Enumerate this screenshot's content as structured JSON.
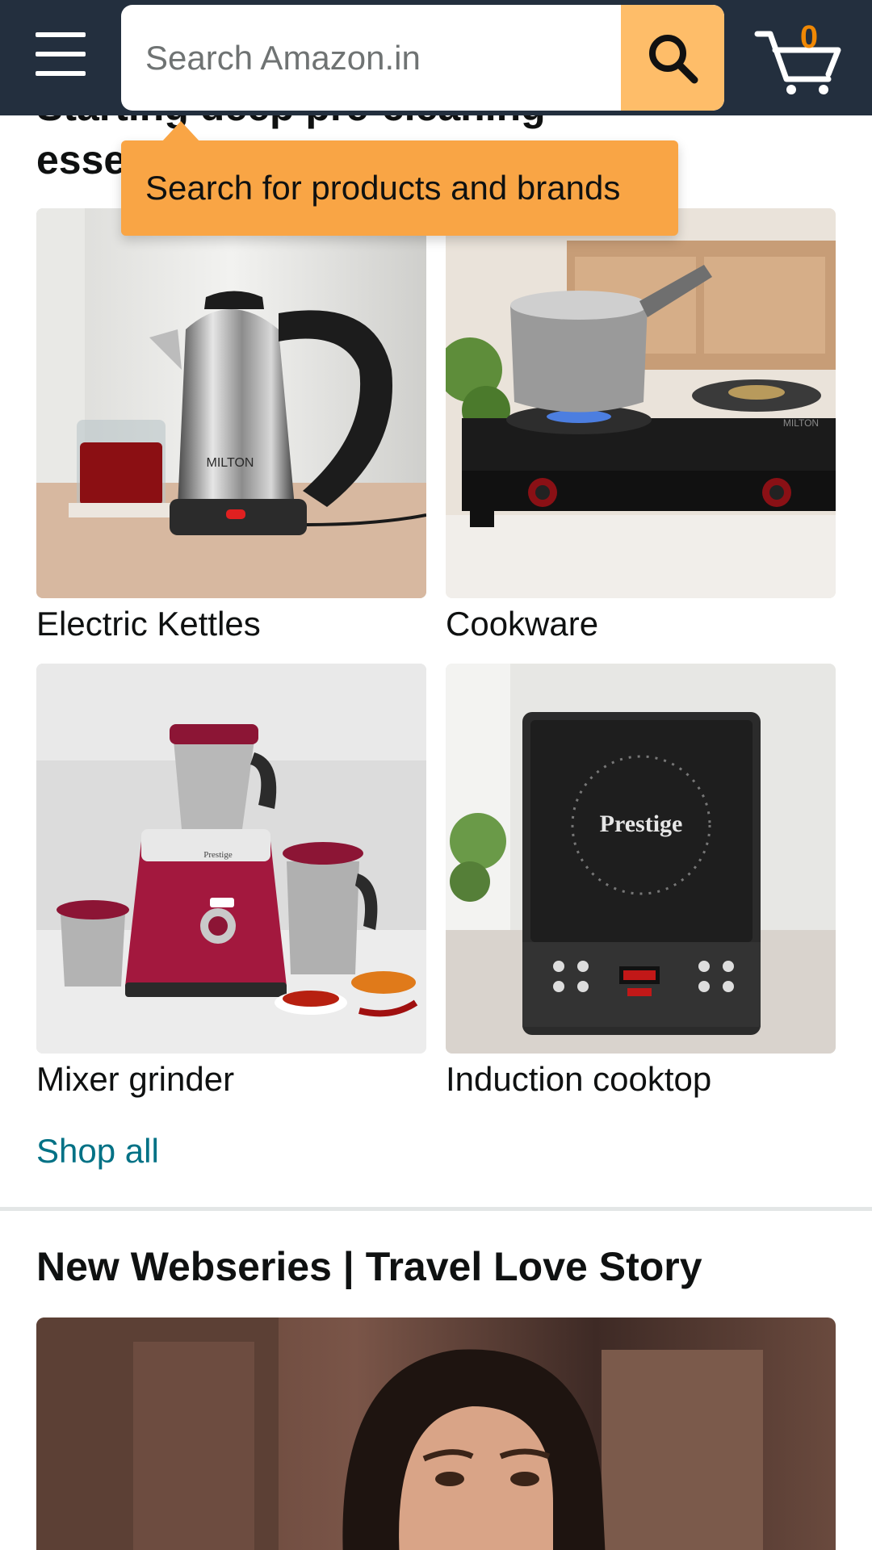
{
  "header": {
    "search_placeholder": "Search Amazon.in",
    "cart_count": "0",
    "bg_color": "#232f3e",
    "search_button_color": "#febd69",
    "icons": [
      "menu-icon",
      "search-icon",
      "cart-icon"
    ]
  },
  "section": {
    "title_top": "Starting deep pre-cleaning",
    "title": "essentials"
  },
  "tooltip": {
    "text": "Search for products and brands",
    "color": "#f9a545"
  },
  "grid": {
    "items": [
      {
        "label": "Electric Kettles"
      },
      {
        "label": "Cookware"
      },
      {
        "label": "Mixer grinder"
      },
      {
        "label": "Induction cooktop"
      }
    ],
    "shop_all": "Shop all",
    "link_color": "#007185"
  },
  "kettle_brand": "MILTON",
  "stove_brand": "MILTON",
  "cooktop_brand": "Prestige",
  "mixer_brand": "Prestige",
  "webseries": {
    "title": "New Webseries | Travel Love Story"
  }
}
